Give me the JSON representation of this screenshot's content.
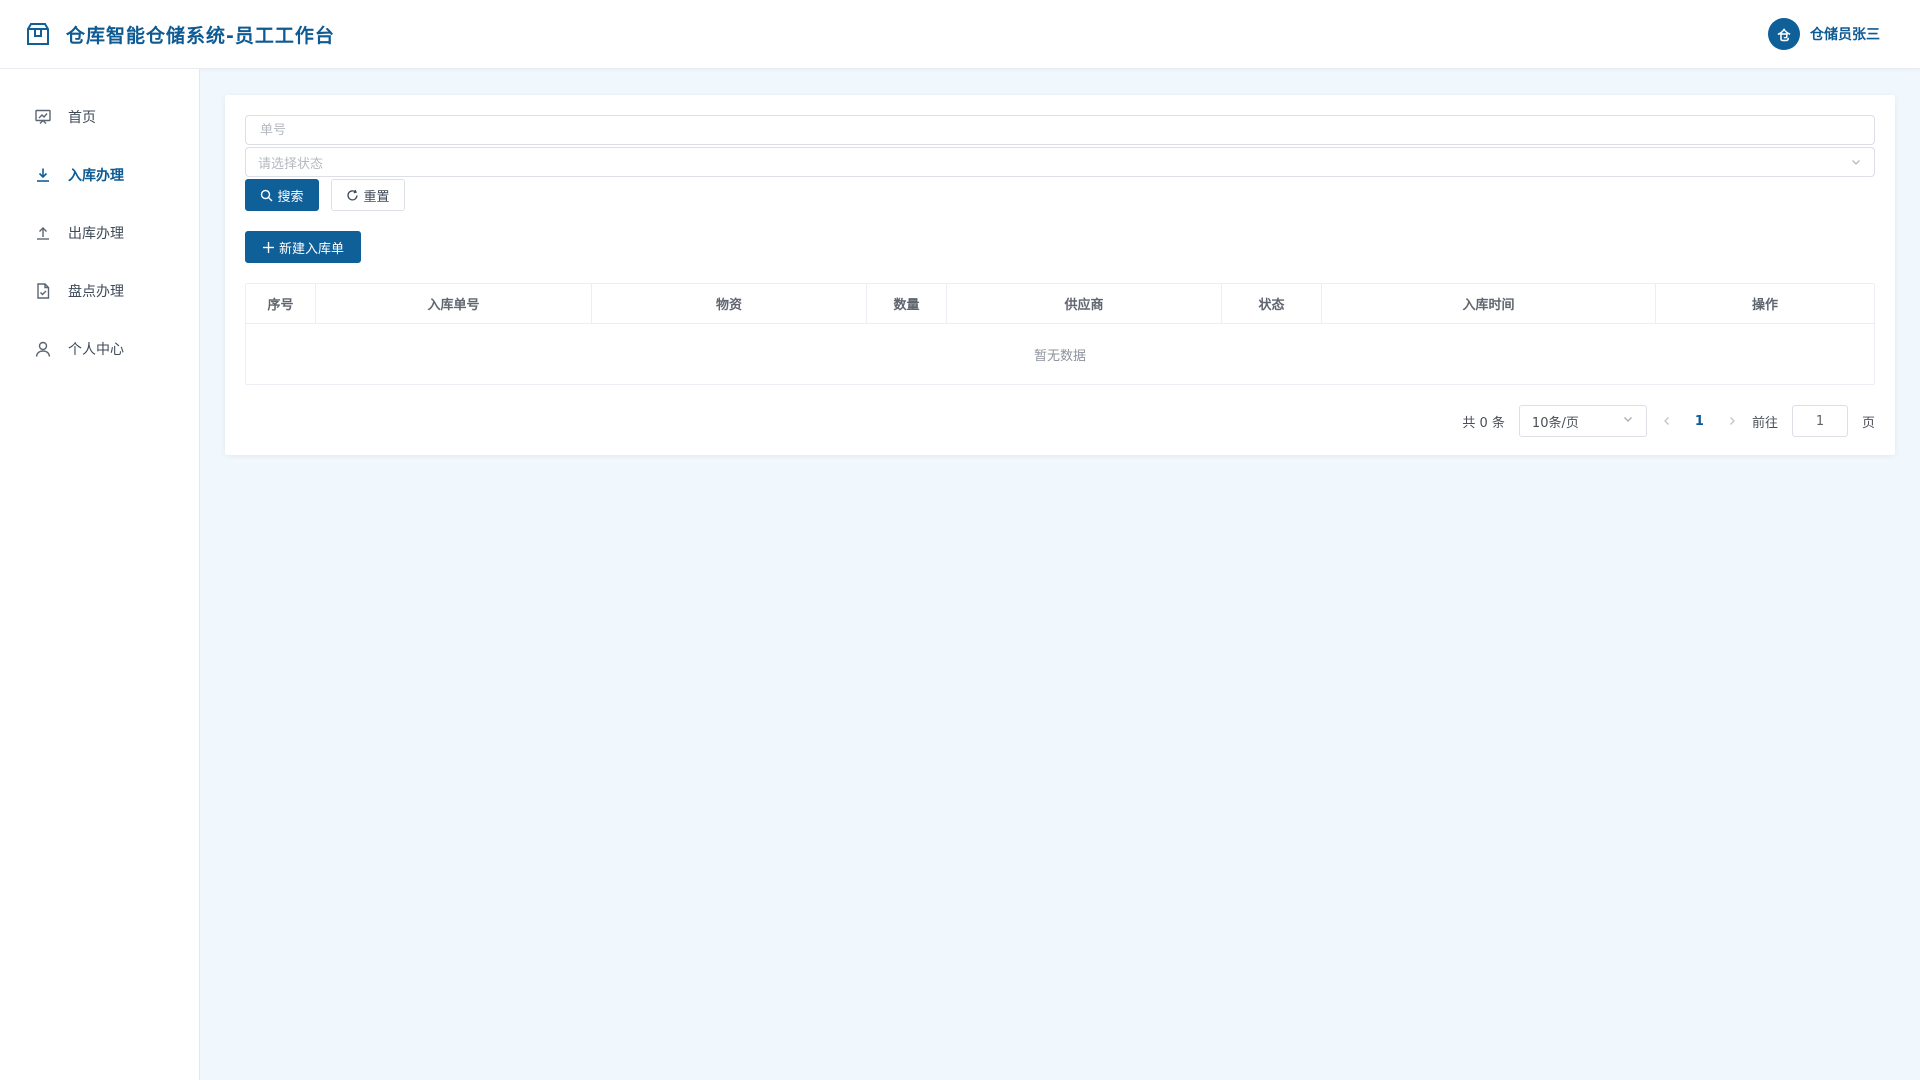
{
  "header": {
    "title": "仓库智能仓储系统-员工工作台",
    "avatar_text": "仓",
    "user_name": "仓储员张三"
  },
  "sidebar": {
    "items": [
      {
        "label": "首页",
        "icon": "dashboard-icon",
        "active": false
      },
      {
        "label": "入库办理",
        "icon": "download-icon",
        "active": true
      },
      {
        "label": "出库办理",
        "icon": "upload-icon",
        "active": false
      },
      {
        "label": "盘点办理",
        "icon": "check-document-icon",
        "active": false
      },
      {
        "label": "个人中心",
        "icon": "user-icon",
        "active": false
      }
    ]
  },
  "search": {
    "order_placeholder": "单号",
    "status_placeholder": "请选择状态",
    "search_label": "搜索",
    "reset_label": "重置"
  },
  "toolbar": {
    "add_label": "新建入库单"
  },
  "table": {
    "columns": [
      "序号",
      "入库单号",
      "物资",
      "数量",
      "供应商",
      "状态",
      "入库时间",
      "操作"
    ],
    "empty_text": "暂无数据"
  },
  "pagination": {
    "total_text": "共 0 条",
    "page_size": "10条/页",
    "current_page": "1",
    "goto_label": "前往",
    "goto_value": "1",
    "page_suffix": "页"
  },
  "colors": {
    "primary": "#0f5f99",
    "background": "#f0f7fd"
  }
}
